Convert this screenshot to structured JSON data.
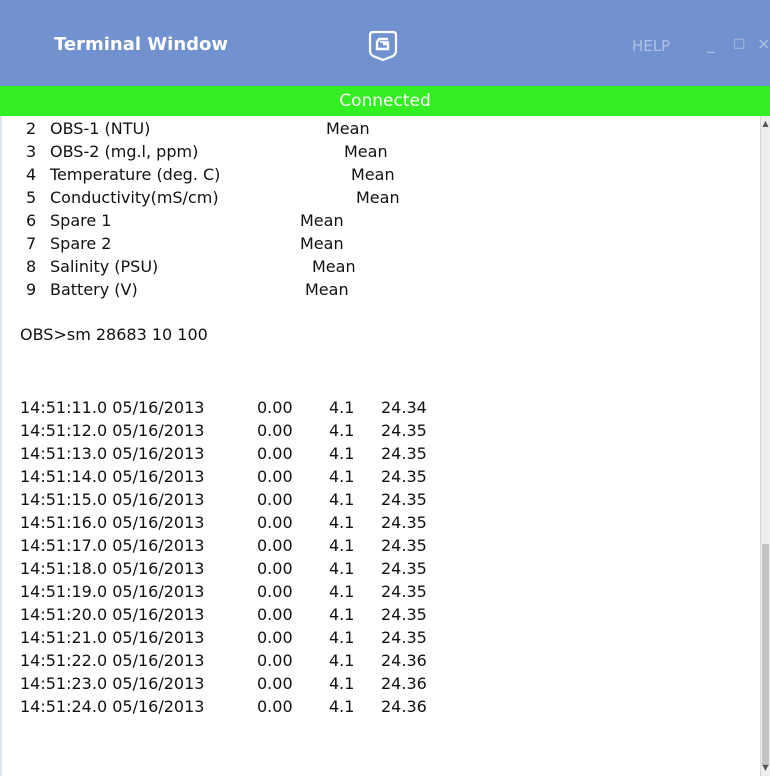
{
  "window": {
    "title": "Terminal Window",
    "help_label": "HELP",
    "minimize_glyph": "_",
    "maximize_glyph": "□",
    "close_glyph": "×",
    "logo_icon": "campbell-scientific-logo",
    "titlebar_color": "#7192cf"
  },
  "status": {
    "text": "Connected",
    "color": "#33ee22"
  },
  "channels": [
    {
      "num": "2",
      "name": "OBS-1 (NTU)",
      "mode": "Mean"
    },
    {
      "num": "3",
      "name": "OBS-2 (mg.l, ppm)",
      "mode": "Mean"
    },
    {
      "num": "4",
      "name": "Temperature (deg. C)",
      "mode": "Mean"
    },
    {
      "num": "5",
      "name": "Conductivity(mS/cm)",
      "mode": "Mean"
    },
    {
      "num": "6",
      "name": "Spare 1",
      "mode": "Mean"
    },
    {
      "num": "7",
      "name": "Spare 2",
      "mode": "Mean"
    },
    {
      "num": "8",
      "name": "Salinity (PSU)",
      "mode": "Mean"
    },
    {
      "num": "9",
      "name": "Battery (V)",
      "mode": "Mean"
    }
  ],
  "command": "OBS>sm 28683 10 100",
  "readings": [
    {
      "timestamp": "14:51:11.0 05/16/2013",
      "v1": "0.00",
      "v2": "4.1",
      "v3": "24.34"
    },
    {
      "timestamp": "14:51:12.0 05/16/2013",
      "v1": "0.00",
      "v2": "4.1",
      "v3": "24.35"
    },
    {
      "timestamp": "14:51:13.0 05/16/2013",
      "v1": "0.00",
      "v2": "4.1",
      "v3": "24.35"
    },
    {
      "timestamp": "14:51:14.0 05/16/2013",
      "v1": "0.00",
      "v2": "4.1",
      "v3": "24.35"
    },
    {
      "timestamp": "14:51:15.0 05/16/2013",
      "v1": "0.00",
      "v2": "4.1",
      "v3": "24.35"
    },
    {
      "timestamp": "14:51:16.0 05/16/2013",
      "v1": "0.00",
      "v2": "4.1",
      "v3": "24.35"
    },
    {
      "timestamp": "14:51:17.0 05/16/2013",
      "v1": "0.00",
      "v2": "4.1",
      "v3": "24.35"
    },
    {
      "timestamp": "14:51:18.0 05/16/2013",
      "v1": "0.00",
      "v2": "4.1",
      "v3": "24.35"
    },
    {
      "timestamp": "14:51:19.0 05/16/2013",
      "v1": "0.00",
      "v2": "4.1",
      "v3": "24.35"
    },
    {
      "timestamp": "14:51:20.0 05/16/2013",
      "v1": "0.00",
      "v2": "4.1",
      "v3": "24.35"
    },
    {
      "timestamp": "14:51:21.0 05/16/2013",
      "v1": "0.00",
      "v2": "4.1",
      "v3": "24.35"
    },
    {
      "timestamp": "14:51:22.0 05/16/2013",
      "v1": "0.00",
      "v2": "4.1",
      "v3": "24.36"
    },
    {
      "timestamp": "14:51:23.0 05/16/2013",
      "v1": "0.00",
      "v2": "4.1",
      "v3": "24.36"
    },
    {
      "timestamp": "14:51:24.0 05/16/2013",
      "v1": "0.00",
      "v2": "4.1",
      "v3": "24.36"
    }
  ]
}
